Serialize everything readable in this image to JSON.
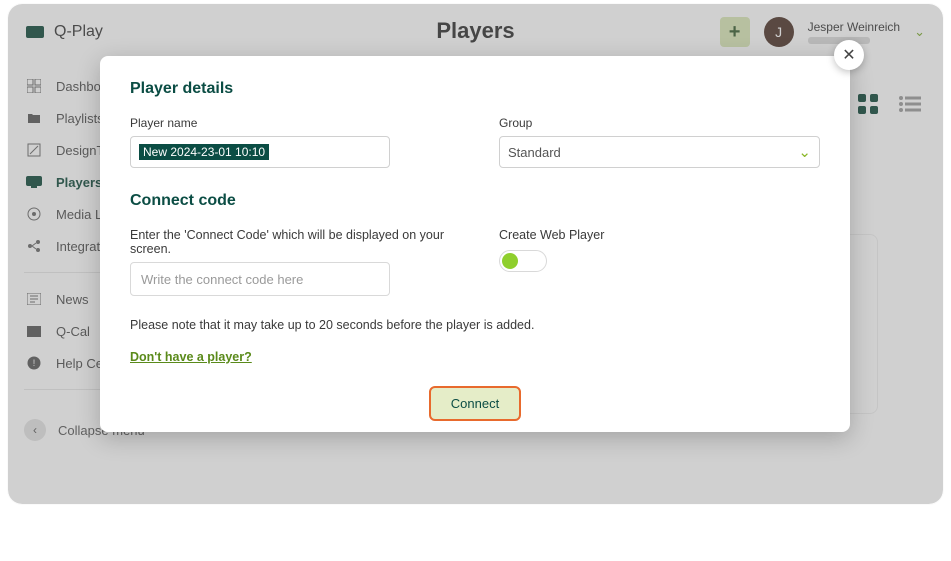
{
  "brand": "Q-Play",
  "page_title": "Players",
  "topbar": {
    "add_label": "+",
    "user_initial": "J",
    "user_name": "Jesper Weinreich"
  },
  "sidebar": {
    "items": [
      {
        "label": "Dashboard"
      },
      {
        "label": "Playlists"
      },
      {
        "label": "DesignTool"
      },
      {
        "label": "Players"
      },
      {
        "label": "Media Library"
      },
      {
        "label": "Integrations"
      }
    ],
    "extra": [
      {
        "label": "News"
      },
      {
        "label": "Q-Cal"
      },
      {
        "label": "Help Center"
      }
    ],
    "collapse_label": "Collapse menu"
  },
  "modal": {
    "heading1": "Player details",
    "player_name_label": "Player name",
    "player_name_value": "New 2024-23-01 10:10",
    "group_label": "Group",
    "group_value": "Standard",
    "heading2": "Connect code",
    "code_hint": "Enter the 'Connect Code' which will be displayed on your screen.",
    "code_placeholder": "Write the connect code here",
    "web_player_label": "Create Web Player",
    "note": "Please note that it may take up to 20 seconds before the player is added.",
    "no_player_link": "Don't have a player?",
    "connect_label": "Connect"
  }
}
